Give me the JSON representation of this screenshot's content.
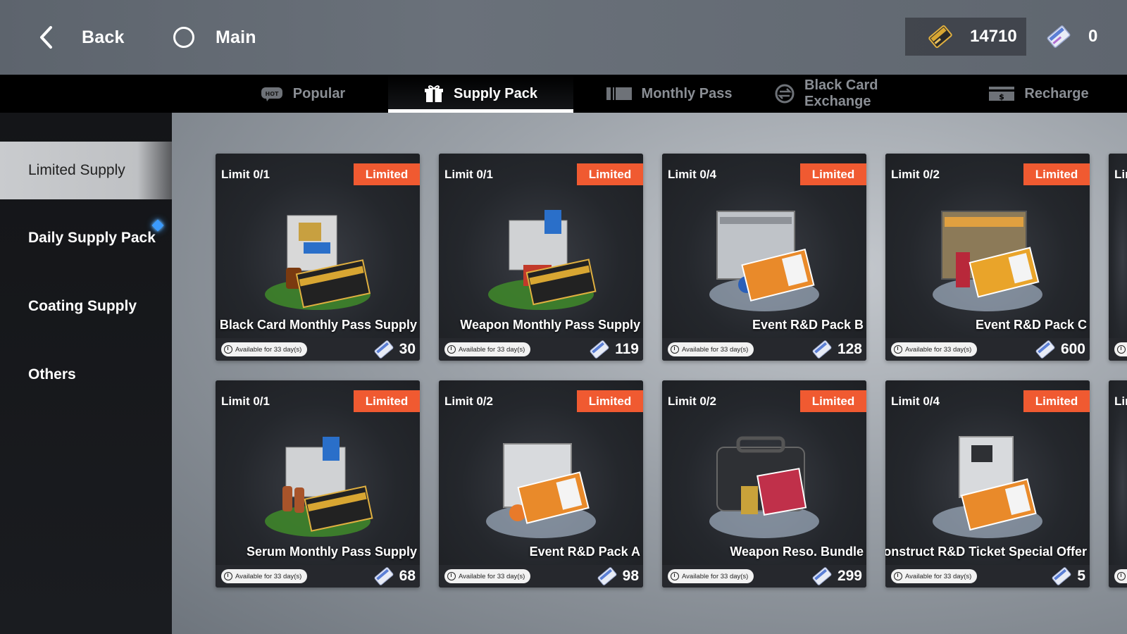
{
  "header": {
    "back_label": "Back",
    "main_label": "Main",
    "currency_primary": "14710",
    "currency_secondary": "0"
  },
  "tabs": [
    {
      "label": "Popular",
      "icon": "hot-icon",
      "badge": "HOT"
    },
    {
      "label": "Supply Pack",
      "icon": "gift-icon"
    },
    {
      "label": "Monthly Pass",
      "icon": "pass-card-icon"
    },
    {
      "label": "Black Card Exchange",
      "icon": "exchange-icon"
    },
    {
      "label": "Recharge",
      "icon": "dollar-card-icon"
    }
  ],
  "sidebar": {
    "items": [
      {
        "label": "Limited Supply"
      },
      {
        "label": "Daily Supply Pack"
      },
      {
        "label": "Coating Supply"
      },
      {
        "label": "Others"
      }
    ]
  },
  "cards": [
    {
      "limit": "Limit 0/1",
      "badge": "Limited",
      "name": "Black Card Monthly Pass Supply",
      "availability": "Available for 33 day(s)",
      "price": "30",
      "art": "monthly-pass-bag"
    },
    {
      "limit": "Limit 0/1",
      "badge": "Limited",
      "name": "Weapon Monthly Pass Supply",
      "availability": "Available for 33 day(s)",
      "price": "119",
      "art": "weapon-pass-box"
    },
    {
      "limit": "Limit 0/4",
      "badge": "Limited",
      "name": "Event R&D Pack B",
      "availability": "Available for 33 day(s)",
      "price": "128",
      "art": "silver-case"
    },
    {
      "limit": "Limit 0/2",
      "badge": "Limited",
      "name": "Event R&D Pack C",
      "availability": "Available for 33 day(s)",
      "price": "600",
      "art": "gold-case"
    },
    {
      "limit": "Limit 0/1",
      "badge": "Limited",
      "name": "Serum Monthly Pass Supply",
      "availability": "Available for 33 day(s)",
      "price": "68",
      "art": "serum-pass-box"
    },
    {
      "limit": "Limit 0/2",
      "badge": "Limited",
      "name": "Event R&D Pack A",
      "availability": "Available for 33 day(s)",
      "price": "98",
      "art": "white-case"
    },
    {
      "limit": "Limit 0/2",
      "badge": "Limited",
      "name": "Weapon Reso. Bundle",
      "availability": "Available for 33 day(s)",
      "price": "299",
      "art": "dark-chest"
    },
    {
      "limit": "Limit 0/4",
      "badge": "Limited",
      "name": "Construct R&D Ticket Special Offer",
      "availability": "Available for 33 day(s)",
      "price": "5",
      "art": "ticket-bag"
    }
  ],
  "partial_cards": [
    {
      "limit": "Lin"
    },
    {
      "limit": "Lin"
    }
  ],
  "colors": {
    "badge": "#f05a31",
    "accent_diamond": "#3b9bff",
    "card_bg": "#1e2024"
  }
}
